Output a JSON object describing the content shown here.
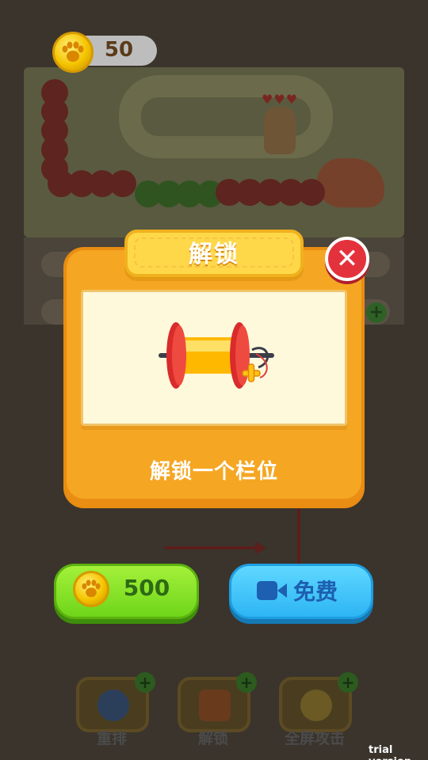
{
  "hud": {
    "coins": "50",
    "coin_icon": "paw-coin-icon"
  },
  "popup": {
    "title": "解锁",
    "description": "解锁一个栏位",
    "item_icon": "thread-spool-icon",
    "close_icon": "close-icon"
  },
  "buttons": {
    "coin_price": "500",
    "free_label": "免费",
    "free_icon": "video-camera-icon"
  },
  "toolbar": [
    {
      "label": "重排",
      "icon": "globe-icon"
    },
    {
      "label": "解锁",
      "icon": "thread-spool-icon"
    },
    {
      "label": "全屏攻击",
      "icon": "star-burst-icon"
    }
  ],
  "watermark": "trial version",
  "colors": {
    "dialog": "#f5a622",
    "banner": "#ffd84a",
    "close": "#e4323c",
    "green_button": "#7fdd22",
    "blue_button": "#36bcf6"
  }
}
